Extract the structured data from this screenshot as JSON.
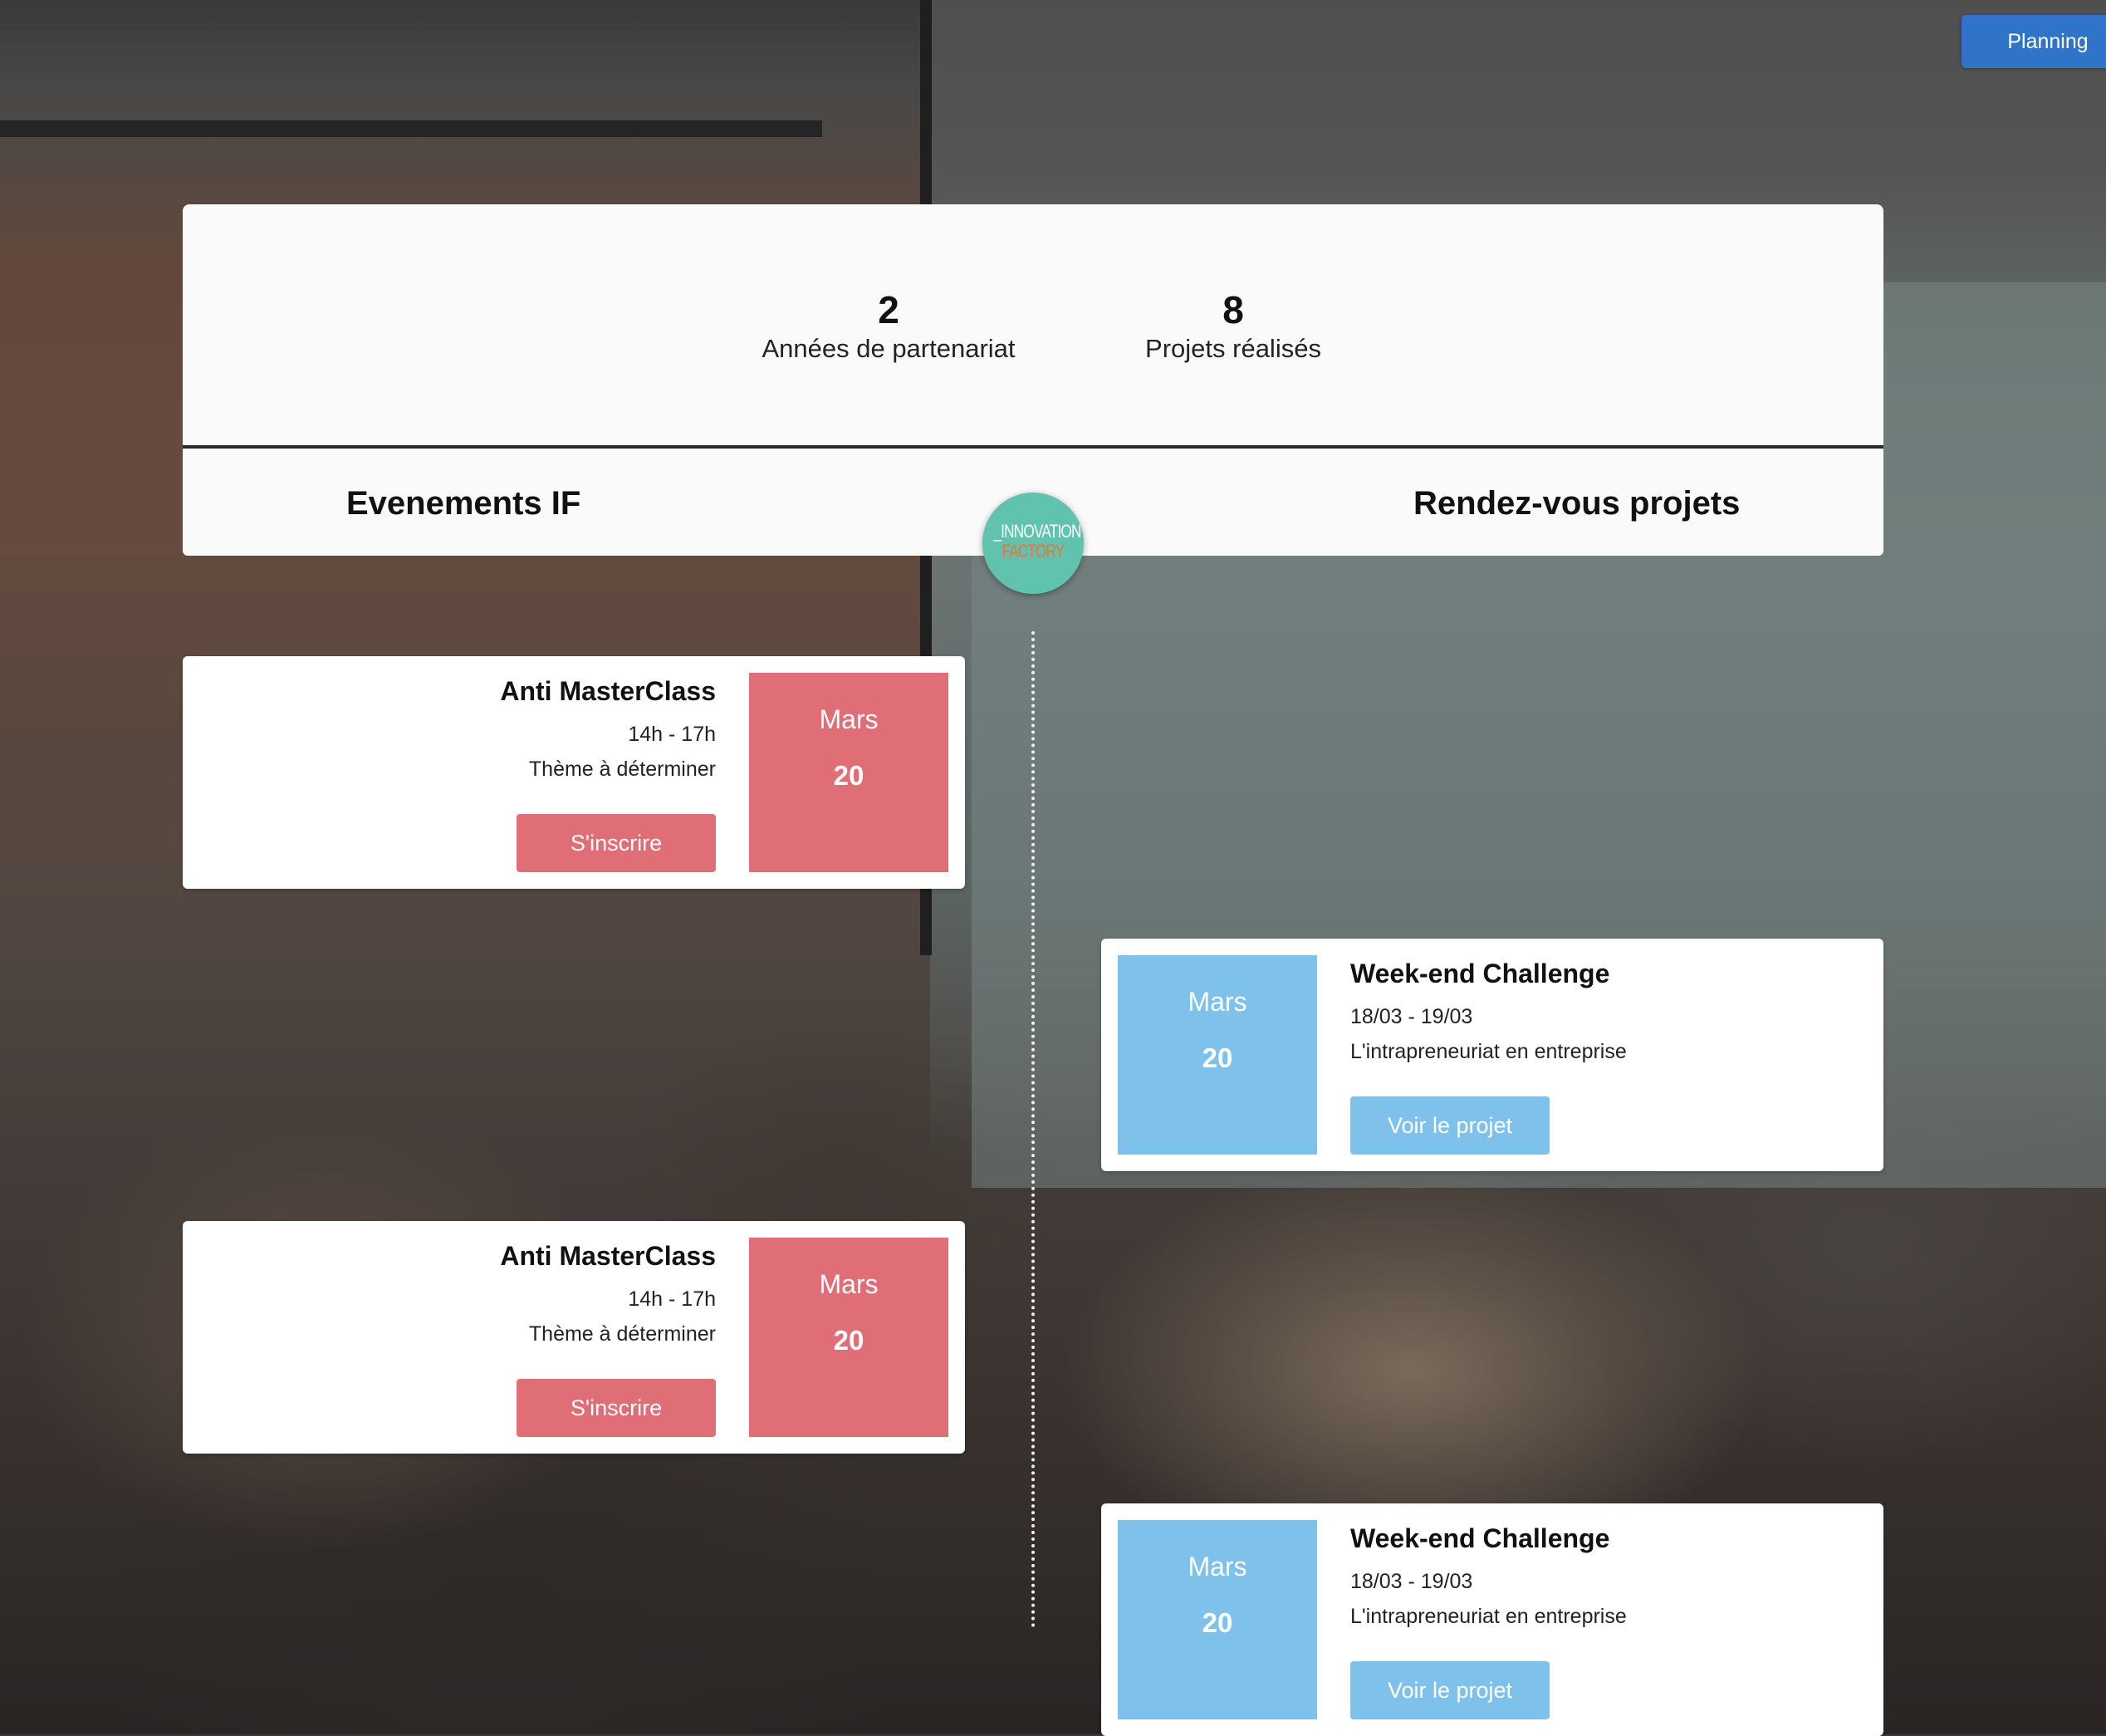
{
  "header": {
    "planning_label": "Planning"
  },
  "stats": [
    {
      "value": "2",
      "label": "Années de partenariat"
    },
    {
      "value": "8",
      "label": "Projets réalisés"
    }
  ],
  "sections": {
    "events_title": "Evenements IF",
    "projects_title": "Rendez-vous projets"
  },
  "logo": {
    "line1": "_INNOVATION",
    "line2": "FACTORY"
  },
  "events": [
    {
      "title": "Anti MasterClass",
      "time": "14h - 17h",
      "theme": "Thème à déterminer",
      "month": "Mars",
      "day": "20",
      "action_label": "S'inscrire"
    },
    {
      "title": "Anti MasterClass",
      "time": "14h - 17h",
      "theme": "Thème à déterminer",
      "month": "Mars",
      "day": "20",
      "action_label": "S'inscrire"
    }
  ],
  "projects": [
    {
      "title": "Week-end Challenge",
      "dates": "18/03 - 19/03",
      "subject": "L'intrapreneuriat en entreprise",
      "month": "Mars",
      "day": "20",
      "action_label": "Voir le projet"
    },
    {
      "title": "Week-end Challenge",
      "dates": "18/03 - 19/03",
      "subject": "L'intrapreneuriat en entreprise",
      "month": "Mars",
      "day": "20",
      "action_label": "Voir le projet"
    }
  ],
  "colors": {
    "event_accent": "#e06e76",
    "project_accent": "#7ec1ea",
    "planning_button": "#2f74c9",
    "logo_bg": "#5fc3ad",
    "logo_factory": "#f0713c"
  }
}
